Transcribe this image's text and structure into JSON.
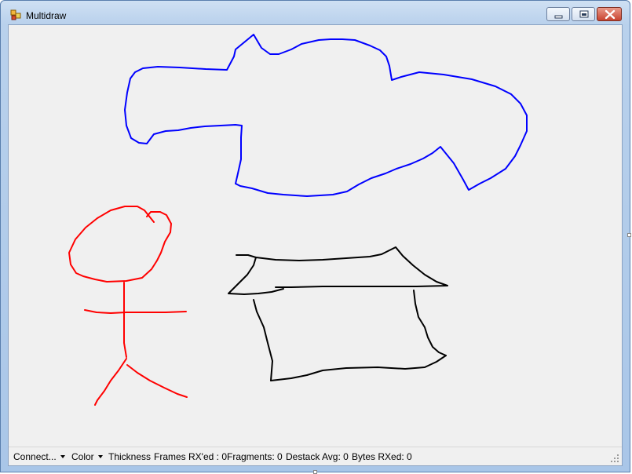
{
  "window": {
    "title": "Multidraw",
    "icon": "multidraw-app-icon"
  },
  "caption_buttons": {
    "minimize_icon": "minimize-icon",
    "maximize_icon": "restore-icon",
    "close_icon": "close-icon"
  },
  "canvas": {
    "background": "#f0f0f0",
    "strokes": [
      {
        "name": "cloud-stroke",
        "color": "#0000ff"
      },
      {
        "name": "stick-figure-stroke",
        "color": "#ff0000"
      },
      {
        "name": "house-stroke",
        "color": "#000000"
      }
    ]
  },
  "statusbar": {
    "connect_label": "Connect...",
    "color_label": "Color",
    "thickness_label": "Thickness",
    "frames_rx": "Frames RX'ed : 0",
    "fragments": "Fragments: 0",
    "destack_avg": "Destack Avg: 0",
    "bytes_rx": "Bytes RXed: 0"
  }
}
